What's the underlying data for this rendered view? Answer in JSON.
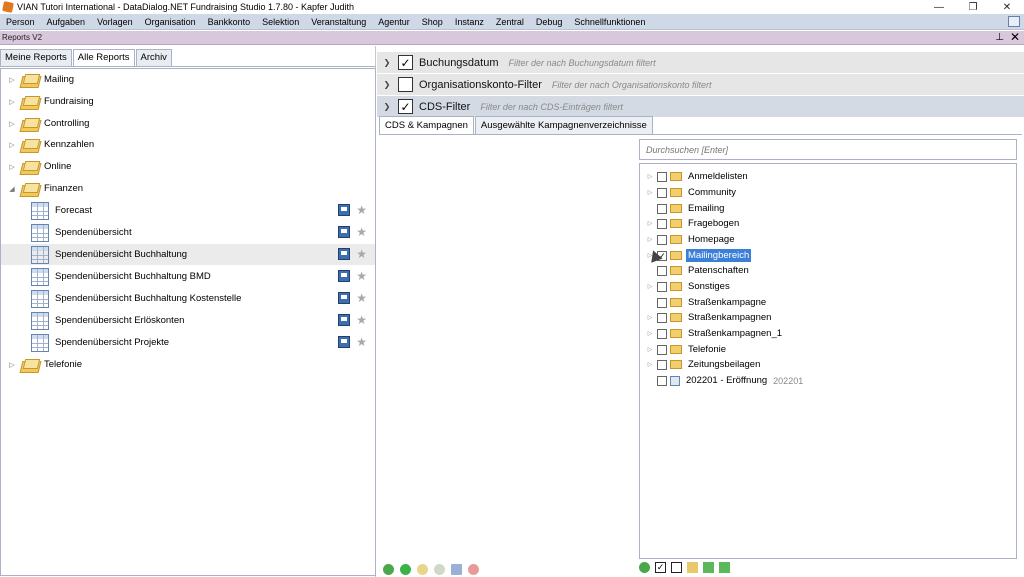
{
  "window": {
    "title": "VIAN Tutori International - DataDialog.NET Fundraising Studio 1.7.80 - Kapfer Judith",
    "controls": [
      "—",
      "❐",
      "✕"
    ]
  },
  "menu": [
    "Person",
    "Aufgaben",
    "Vorlagen",
    "Organisation",
    "Bankkonto",
    "Selektion",
    "Veranstaltung",
    "Agentur",
    "Shop",
    "Instanz",
    "Zentral",
    "Debug",
    "Schnellfunktionen"
  ],
  "doc": {
    "title": "Reports V2",
    "pin": "⊥",
    "close": "✕"
  },
  "left": {
    "tabs": [
      "Meine Reports",
      "Alle Reports",
      "Archiv"
    ],
    "active_tab": 1,
    "tree": [
      {
        "type": "folder",
        "label": "Mailing",
        "expanded": false
      },
      {
        "type": "folder",
        "label": "Fundraising",
        "expanded": false
      },
      {
        "type": "folder",
        "label": "Controlling",
        "expanded": false
      },
      {
        "type": "folder",
        "label": "Kennzahlen",
        "expanded": false
      },
      {
        "type": "folder",
        "label": "Online",
        "expanded": false
      },
      {
        "type": "folder",
        "label": "Finanzen",
        "expanded": true
      },
      {
        "type": "report",
        "label": "Forecast"
      },
      {
        "type": "report",
        "label": "Spendenübersicht"
      },
      {
        "type": "report",
        "label": "Spendenübersicht Buchhaltung",
        "selected": true
      },
      {
        "type": "report",
        "label": "Spendenübersicht Buchhaltung BMD"
      },
      {
        "type": "report",
        "label": "Spendenübersicht Buchhaltung Kostenstelle"
      },
      {
        "type": "report",
        "label": "Spendenübersicht Erlöskonten"
      },
      {
        "type": "report",
        "label": "Spendenübersicht Projekte"
      },
      {
        "type": "folder",
        "label": "Telefonie",
        "expanded": false
      }
    ]
  },
  "filters": [
    {
      "title": "Buchungsdatum",
      "desc": "Filter der nach Buchungsdatum filtert",
      "checked": true,
      "expanded": false
    },
    {
      "title": "Organisationskonto-Filter",
      "desc": "Filter der nach Organisationskonto filtert",
      "checked": false,
      "expanded": false
    },
    {
      "title": "CDS-Filter",
      "desc": "Filter der nach CDS-Einträgen filtert",
      "checked": true,
      "expanded": true
    }
  ],
  "cds": {
    "tabs": [
      "CDS & Kampagnen",
      "Ausgewählte Kampagnenverzeichnisse"
    ],
    "active_tab": 0,
    "search_placeholder": "Durchsuchen [Enter]",
    "items": [
      {
        "label": "Anmeldelisten",
        "expandable": true,
        "checked": false
      },
      {
        "label": "Community",
        "expandable": true,
        "checked": false
      },
      {
        "label": "Emailing",
        "expandable": false,
        "checked": false
      },
      {
        "label": "Fragebogen",
        "expandable": true,
        "checked": false
      },
      {
        "label": "Homepage",
        "expandable": true,
        "checked": false
      },
      {
        "label": "Mailingbereich",
        "expandable": true,
        "checked": true,
        "selected": true
      },
      {
        "label": "Patenschaften",
        "expandable": false,
        "checked": false
      },
      {
        "label": "Sonstiges",
        "expandable": true,
        "checked": false
      },
      {
        "label": "Straßenkampagne",
        "expandable": false,
        "checked": false
      },
      {
        "label": "Straßenkampagnen",
        "expandable": true,
        "checked": false
      },
      {
        "label": "Straßenkampagnen_1",
        "expandable": true,
        "checked": false
      },
      {
        "label": "Telefonie",
        "expandable": true,
        "checked": false
      },
      {
        "label": "Zeitungsbeilagen",
        "expandable": true,
        "checked": false
      },
      {
        "label": "202201 - Eröffnung",
        "expandable": false,
        "checked": false,
        "doc": true,
        "code": "202201"
      }
    ]
  },
  "colors": {
    "menubar": "#cfd8e6",
    "docbar": "#d8c8dc",
    "selection": "#3c7fd6"
  }
}
